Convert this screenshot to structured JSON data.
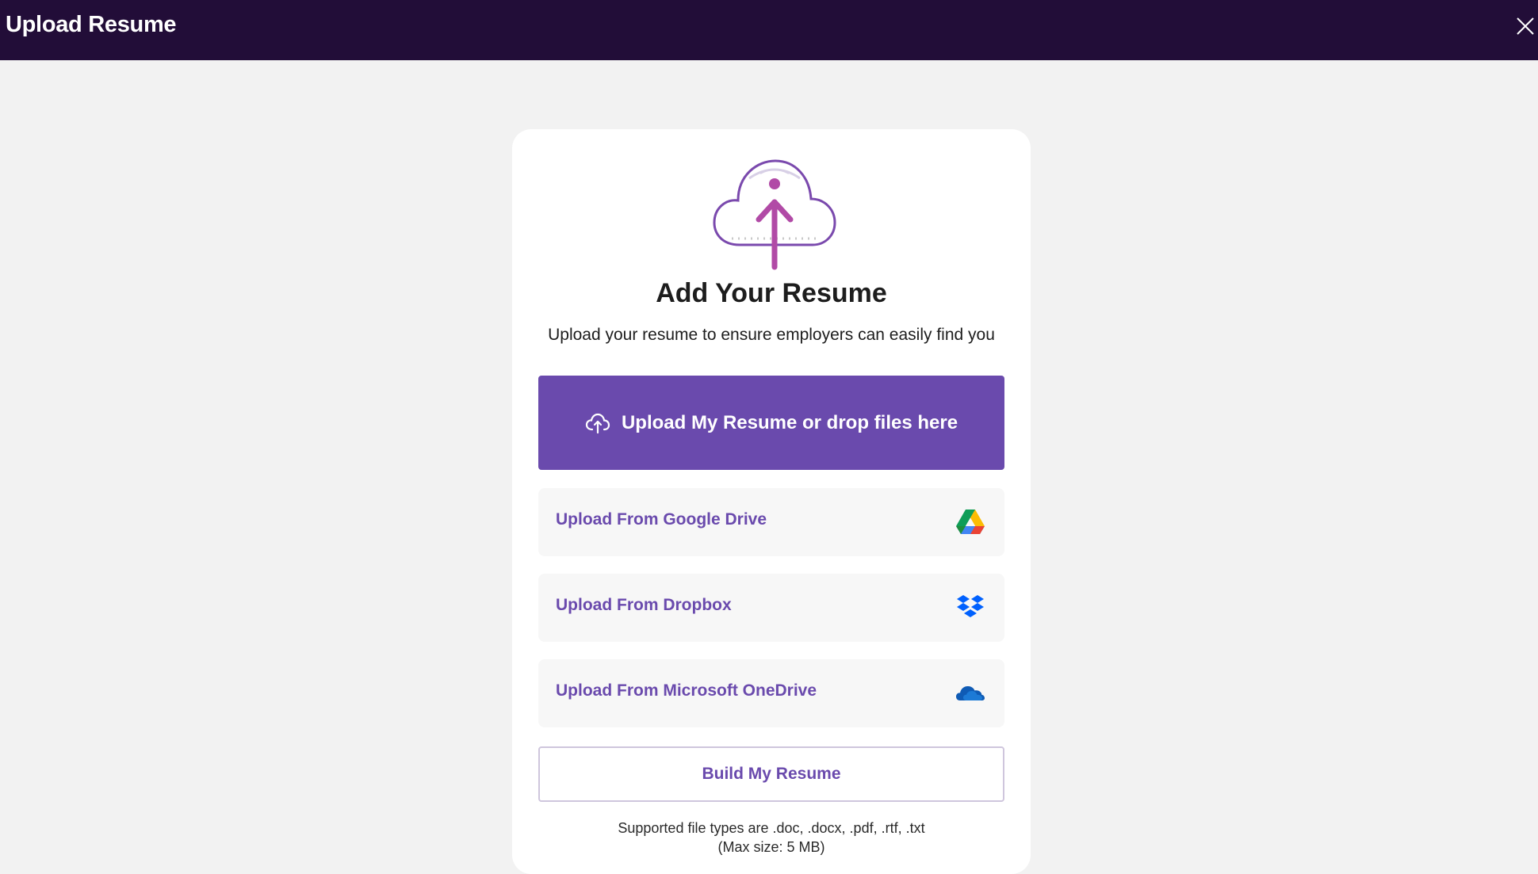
{
  "header": {
    "title": "Upload Resume",
    "close_icon": "close-icon"
  },
  "card": {
    "hero_icon": "cloud-upload-icon",
    "heading": "Add Your Resume",
    "subheading": "Upload your resume to ensure employers can easily find you",
    "primary_button": {
      "label": "Upload My Resume or drop files here",
      "icon": "cloud-upload-icon"
    },
    "sources": [
      {
        "label": "Upload From Google Drive",
        "icon": "google-drive-icon"
      },
      {
        "label": "Upload From Dropbox",
        "icon": "dropbox-icon"
      },
      {
        "label": "Upload From Microsoft OneDrive",
        "icon": "onedrive-icon"
      }
    ],
    "build_button": "Build My Resume",
    "note_line1": "Supported file types are .doc, .docx, .pdf, .rtf, .txt",
    "note_line2": "(Max size: 5 MB)"
  },
  "colors": {
    "header_bg": "#220d38",
    "accent": "#6a4aad",
    "page_bg": "#f2f2f2",
    "icon_magenta": "#b14aa6"
  }
}
